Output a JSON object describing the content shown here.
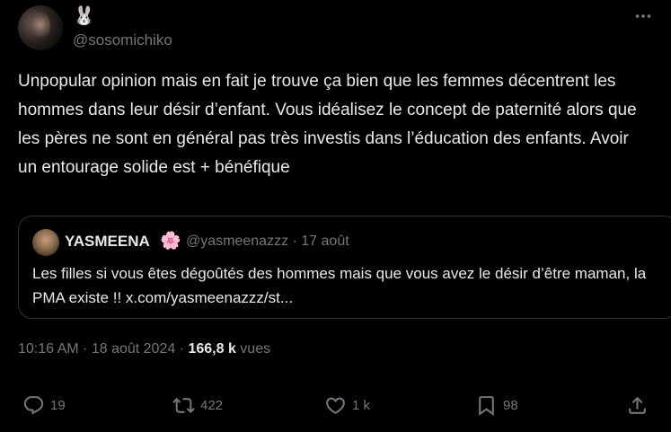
{
  "author": {
    "display_name": "🐰",
    "handle": "@sosomichiko"
  },
  "tweet": {
    "text": "Unpopular opinion mais en fait je trouve ça bien que les femmes décentrent les hommes dans leur désir d’enfant. Vous idéalisez le concept de paternité alors que les pères ne sont en général pas très investis dans l’éducation des enfants. Avoir un entourage solide est + bénéfique"
  },
  "quote": {
    "name": "YASMEENA",
    "emoji": "🌸",
    "handle_date": "@yasmeenazzz · 17 août",
    "text": "Les filles si vous êtes dégoûtés des hommes mais que vous avez le désir d’être maman, la PMA existe !! x.com/yasmeenazzz/st..."
  },
  "meta": {
    "time_date": "10:16 AM · 18 août 2024 · ",
    "views_count": "166,8 k",
    "views_label": " vues"
  },
  "actions": {
    "reply_count": "19",
    "repost_count": "422",
    "like_count": "1 k",
    "bookmark_count": "98"
  },
  "icons": {
    "more": "more-horizontal-icon",
    "reply": "reply-icon",
    "repost": "repost-icon",
    "like": "heart-icon",
    "bookmark": "bookmark-icon",
    "share": "share-icon"
  },
  "colors": {
    "background": "#000000",
    "text_primary": "#e7e9ea",
    "text_secondary": "#71767b",
    "border": "#2f3336"
  }
}
